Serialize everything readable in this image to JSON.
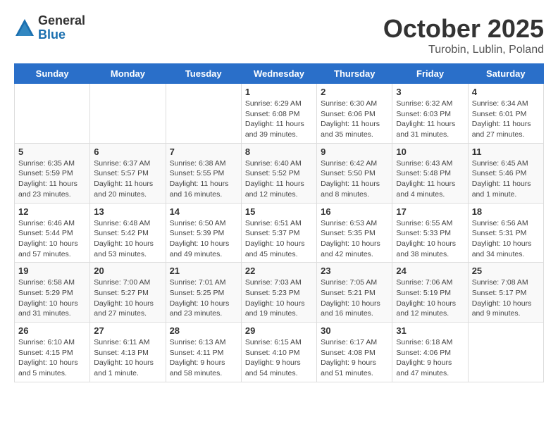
{
  "logo": {
    "general": "General",
    "blue": "Blue"
  },
  "title": {
    "month": "October 2025",
    "location": "Turobin, Lublin, Poland"
  },
  "headers": [
    "Sunday",
    "Monday",
    "Tuesday",
    "Wednesday",
    "Thursday",
    "Friday",
    "Saturday"
  ],
  "weeks": [
    [
      {
        "day": "",
        "info": ""
      },
      {
        "day": "",
        "info": ""
      },
      {
        "day": "",
        "info": ""
      },
      {
        "day": "1",
        "info": "Sunrise: 6:29 AM\nSunset: 6:08 PM\nDaylight: 11 hours\nand 39 minutes."
      },
      {
        "day": "2",
        "info": "Sunrise: 6:30 AM\nSunset: 6:06 PM\nDaylight: 11 hours\nand 35 minutes."
      },
      {
        "day": "3",
        "info": "Sunrise: 6:32 AM\nSunset: 6:03 PM\nDaylight: 11 hours\nand 31 minutes."
      },
      {
        "day": "4",
        "info": "Sunrise: 6:34 AM\nSunset: 6:01 PM\nDaylight: 11 hours\nand 27 minutes."
      }
    ],
    [
      {
        "day": "5",
        "info": "Sunrise: 6:35 AM\nSunset: 5:59 PM\nDaylight: 11 hours\nand 23 minutes."
      },
      {
        "day": "6",
        "info": "Sunrise: 6:37 AM\nSunset: 5:57 PM\nDaylight: 11 hours\nand 20 minutes."
      },
      {
        "day": "7",
        "info": "Sunrise: 6:38 AM\nSunset: 5:55 PM\nDaylight: 11 hours\nand 16 minutes."
      },
      {
        "day": "8",
        "info": "Sunrise: 6:40 AM\nSunset: 5:52 PM\nDaylight: 11 hours\nand 12 minutes."
      },
      {
        "day": "9",
        "info": "Sunrise: 6:42 AM\nSunset: 5:50 PM\nDaylight: 11 hours\nand 8 minutes."
      },
      {
        "day": "10",
        "info": "Sunrise: 6:43 AM\nSunset: 5:48 PM\nDaylight: 11 hours\nand 4 minutes."
      },
      {
        "day": "11",
        "info": "Sunrise: 6:45 AM\nSunset: 5:46 PM\nDaylight: 11 hours\nand 1 minute."
      }
    ],
    [
      {
        "day": "12",
        "info": "Sunrise: 6:46 AM\nSunset: 5:44 PM\nDaylight: 10 hours\nand 57 minutes."
      },
      {
        "day": "13",
        "info": "Sunrise: 6:48 AM\nSunset: 5:42 PM\nDaylight: 10 hours\nand 53 minutes."
      },
      {
        "day": "14",
        "info": "Sunrise: 6:50 AM\nSunset: 5:39 PM\nDaylight: 10 hours\nand 49 minutes."
      },
      {
        "day": "15",
        "info": "Sunrise: 6:51 AM\nSunset: 5:37 PM\nDaylight: 10 hours\nand 45 minutes."
      },
      {
        "day": "16",
        "info": "Sunrise: 6:53 AM\nSunset: 5:35 PM\nDaylight: 10 hours\nand 42 minutes."
      },
      {
        "day": "17",
        "info": "Sunrise: 6:55 AM\nSunset: 5:33 PM\nDaylight: 10 hours\nand 38 minutes."
      },
      {
        "day": "18",
        "info": "Sunrise: 6:56 AM\nSunset: 5:31 PM\nDaylight: 10 hours\nand 34 minutes."
      }
    ],
    [
      {
        "day": "19",
        "info": "Sunrise: 6:58 AM\nSunset: 5:29 PM\nDaylight: 10 hours\nand 31 minutes."
      },
      {
        "day": "20",
        "info": "Sunrise: 7:00 AM\nSunset: 5:27 PM\nDaylight: 10 hours\nand 27 minutes."
      },
      {
        "day": "21",
        "info": "Sunrise: 7:01 AM\nSunset: 5:25 PM\nDaylight: 10 hours\nand 23 minutes."
      },
      {
        "day": "22",
        "info": "Sunrise: 7:03 AM\nSunset: 5:23 PM\nDaylight: 10 hours\nand 19 minutes."
      },
      {
        "day": "23",
        "info": "Sunrise: 7:05 AM\nSunset: 5:21 PM\nDaylight: 10 hours\nand 16 minutes."
      },
      {
        "day": "24",
        "info": "Sunrise: 7:06 AM\nSunset: 5:19 PM\nDaylight: 10 hours\nand 12 minutes."
      },
      {
        "day": "25",
        "info": "Sunrise: 7:08 AM\nSunset: 5:17 PM\nDaylight: 10 hours\nand 9 minutes."
      }
    ],
    [
      {
        "day": "26",
        "info": "Sunrise: 6:10 AM\nSunset: 4:15 PM\nDaylight: 10 hours\nand 5 minutes."
      },
      {
        "day": "27",
        "info": "Sunrise: 6:11 AM\nSunset: 4:13 PM\nDaylight: 10 hours\nand 1 minute."
      },
      {
        "day": "28",
        "info": "Sunrise: 6:13 AM\nSunset: 4:11 PM\nDaylight: 9 hours\nand 58 minutes."
      },
      {
        "day": "29",
        "info": "Sunrise: 6:15 AM\nSunset: 4:10 PM\nDaylight: 9 hours\nand 54 minutes."
      },
      {
        "day": "30",
        "info": "Sunrise: 6:17 AM\nSunset: 4:08 PM\nDaylight: 9 hours\nand 51 minutes."
      },
      {
        "day": "31",
        "info": "Sunrise: 6:18 AM\nSunset: 4:06 PM\nDaylight: 9 hours\nand 47 minutes."
      },
      {
        "day": "",
        "info": ""
      }
    ]
  ]
}
